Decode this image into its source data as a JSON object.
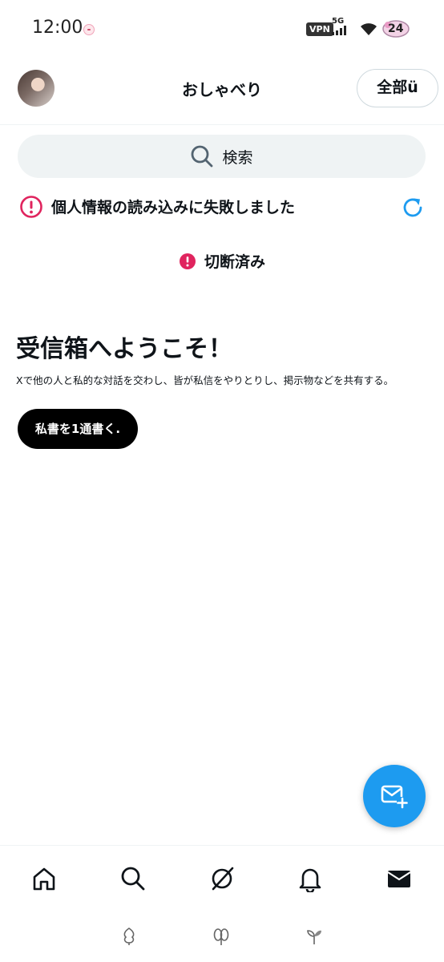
{
  "status_bar": {
    "time": "12:00",
    "vpn": "VPN",
    "network": "5G",
    "battery": "24"
  },
  "header": {
    "title": "おしゃべり",
    "filter_label": "全部ü"
  },
  "search": {
    "label": "検索"
  },
  "error": {
    "message": "個人情報の読み込みに失敗しました"
  },
  "connection": {
    "status": "切断済み"
  },
  "welcome": {
    "title": "受信箱へようこそ！",
    "description": "Xで他の人と私的な対話を交わし、皆が私信をやりとりし、掲示物などを共有する。",
    "button_label": "私書を1通書く."
  },
  "colors": {
    "accent": "#1d9bf0",
    "error": "#e0245e",
    "text": "#0f1419"
  },
  "icons": {
    "nav": [
      "home-icon",
      "search-icon",
      "grok-icon",
      "bell-icon",
      "mail-icon"
    ],
    "fab": "compose-message-icon"
  }
}
